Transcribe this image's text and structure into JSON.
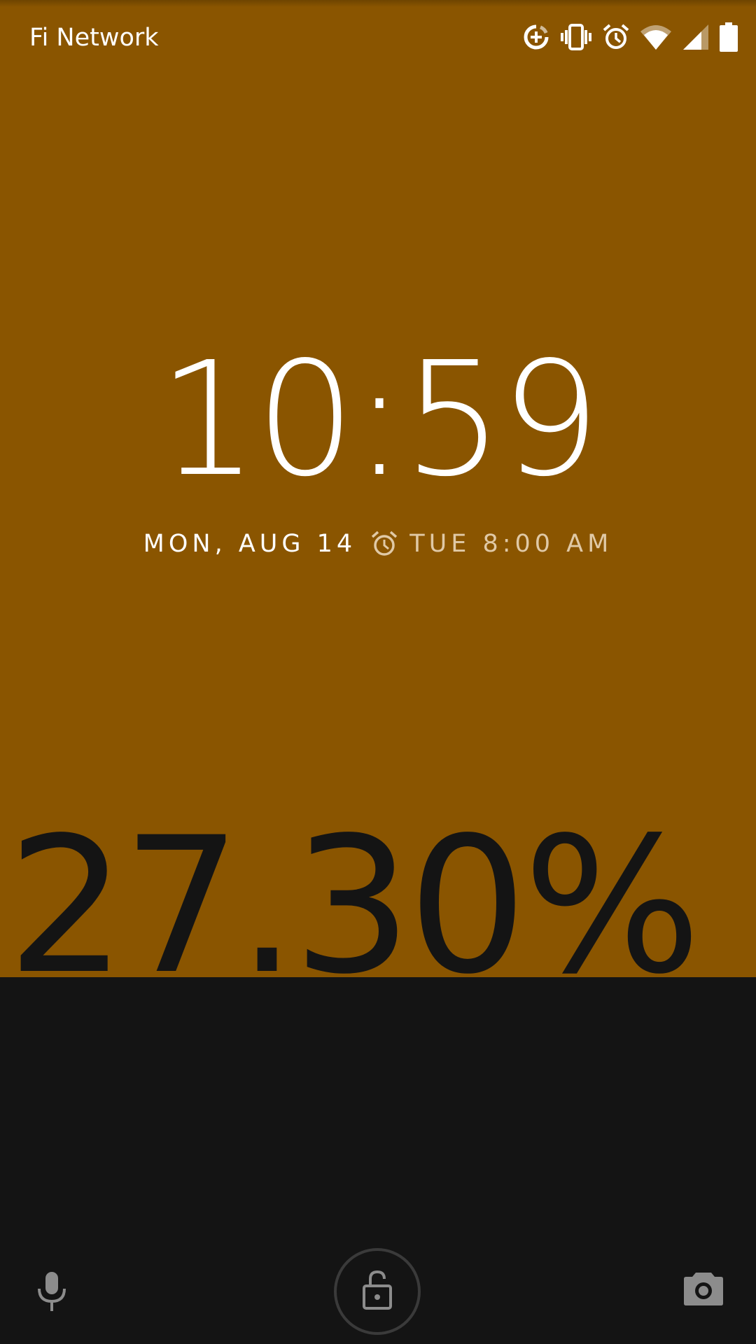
{
  "status_bar": {
    "carrier": "Fi Network",
    "icons": [
      "data-saver-icon",
      "vibrate-icon",
      "alarm-icon",
      "wifi-icon",
      "cell-signal-icon",
      "battery-icon"
    ]
  },
  "lockscreen": {
    "time": "10:59",
    "date": "MON, AUG 14",
    "next_alarm": "TUE 8:00 AM",
    "charge_percent": "27.30%",
    "charge_level": 0.273
  },
  "bottom_actions": [
    "voice-assist-icon",
    "unlock-icon",
    "camera-icon"
  ],
  "colors": {
    "fill": "#8a5500",
    "background": "#141414"
  }
}
